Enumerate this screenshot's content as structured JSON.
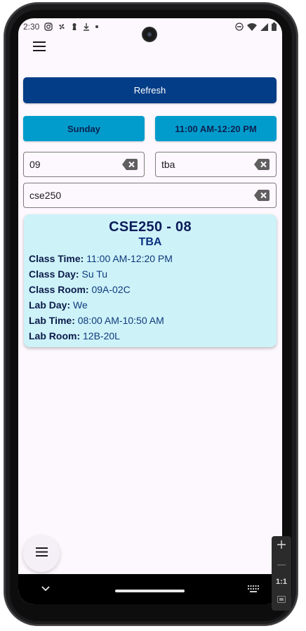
{
  "status_bar": {
    "time": "2:30",
    "left_icons": [
      "instagram-icon",
      "pinwheel-icon",
      "keyhole-icon",
      "download-icon",
      "dot-icon"
    ],
    "right_icons": [
      "do-not-disturb-icon",
      "wifi-icon",
      "signal-icon",
      "battery-icon"
    ]
  },
  "toolbar": {
    "refresh_label": "Refresh"
  },
  "filters": {
    "day_label": "Sunday",
    "time_label": "11:00 AM-12:20 PM",
    "section_value": "09",
    "faculty_value": "tba",
    "course_value": "cse250"
  },
  "card": {
    "title": "CSE250 - 08",
    "faculty": "TBA",
    "rows": [
      {
        "label": "Class Time:",
        "value": "11:00 AM-12:20 PM"
      },
      {
        "label": "Class Day:",
        "value": "Su Tu"
      },
      {
        "label": "Class Room:",
        "value": "09A-02C"
      },
      {
        "label": "Lab Day:",
        "value": "We"
      },
      {
        "label": "Lab Time:",
        "value": "08:00 AM-10:50 AM"
      },
      {
        "label": "Lab Room:",
        "value": "12B-20L"
      }
    ]
  },
  "emulator": {
    "zoom_label": "1:1"
  },
  "colors": {
    "primary": "#033d87",
    "accent": "#029ccc",
    "card_bg": "#cdf2f8",
    "screen_bg": "#fdf8fd"
  }
}
